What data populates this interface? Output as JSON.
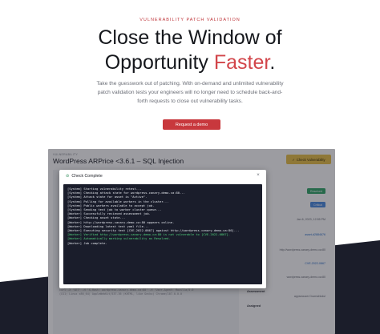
{
  "hero": {
    "eyebrow": "Vulnerability patch validation",
    "headline_line1": "Close the Window of",
    "headline_line2_a": "Opportunity ",
    "headline_line2_accent": "Faster",
    "headline_line2_end": ".",
    "subtext": "Take the guesswork out of patching. With on-demand and unlimited vulnerability patch validation tests your engineers will no longer need to schedule back-and-forth requests to close out vulnerability tasks.",
    "cta_label": "Request a demo"
  },
  "screenshot": {
    "breadcrumb": "VULNERABILITY",
    "title": "WordPress ARPrice <3.6.1 – SQL Injection",
    "check_button": "Check Vulnerability",
    "status_resolved": "Resolved",
    "status_small": "Critical",
    "date": "Jan 6, 2023, 12:55 PM",
    "asset_id": "asset-d2884676",
    "asset_link": "http://wordpress.canary-demo.ca:80",
    "cve": "CVE-2022-0867",
    "target": "wordpress.canary-demo.ca:80",
    "labels": {
      "assessment": "Assessment",
      "assigned": "Assigned",
      "assessment_value": "appsecuser Downchkdul"
    },
    "request_lines": [
      "Request",
      "curl -X 'GET' -H 'X-Host: wordpress.canary-demo.ca:80' -H 'User-Agent: Mozilla/5.0",
      "(X11; Linux x86_64) AppleWebKit/537.36 (KHTML, like Gecko) Chrome/107.0.0.0"
    ]
  },
  "modal": {
    "title": "Check Complete",
    "close_label": "×",
    "log": [
      {
        "text": "[System] Starting vulnerability retest...",
        "ok": false
      },
      {
        "text": "[System] Checking attack state for wordpress.canary-demo.ca:80...",
        "ok": false
      },
      {
        "text": "[System] Attack state for asset is \"Active\".",
        "ok": false
      },
      {
        "text": "[System] Polling for available workers in the cluster...",
        "ok": false
      },
      {
        "text": "[System] Public workers available to accept job.",
        "ok": false
      },
      {
        "text": "[System] Sending test job to worker cluster queue...",
        "ok": false
      },
      {
        "text": "[Worker] Successfully recieved assessment job.",
        "ok": false
      },
      {
        "text": "[Worker] Checking asset state...",
        "ok": false
      },
      {
        "text": "[Worker] http://wordpress.canary-demo.ca:80 appears online.",
        "ok": false
      },
      {
        "text": "[Worker] Downloading latest test yaml file...",
        "ok": false
      },
      {
        "text": "[Worker] Executing security test [CVE-2022-0867] against http://wordpress.canary-demo.ca:80]...",
        "ok": false
      },
      {
        "text": "[Worker] Verified http://wordpress.canary-demo.ca:80 is not vulnerable to [CVE-2022-0867].",
        "ok": true
      },
      {
        "text": "[Worker] Automatically marking vulnerability as Resolved.",
        "ok": true
      },
      {
        "text": "[Worker] Job complete.",
        "ok": false
      }
    ]
  },
  "colors": {
    "accent": "#d2454a",
    "cta": "#c8383d",
    "dark_band": "#1b1d2a",
    "terminal_bg": "#1a1d2b",
    "ok_text": "#52d57e",
    "check_button": "#e9c14a"
  },
  "icons": {
    "modal_title_icon": "check-circle-icon",
    "check_button_icon": "check-circle-icon",
    "close": "close-icon"
  }
}
